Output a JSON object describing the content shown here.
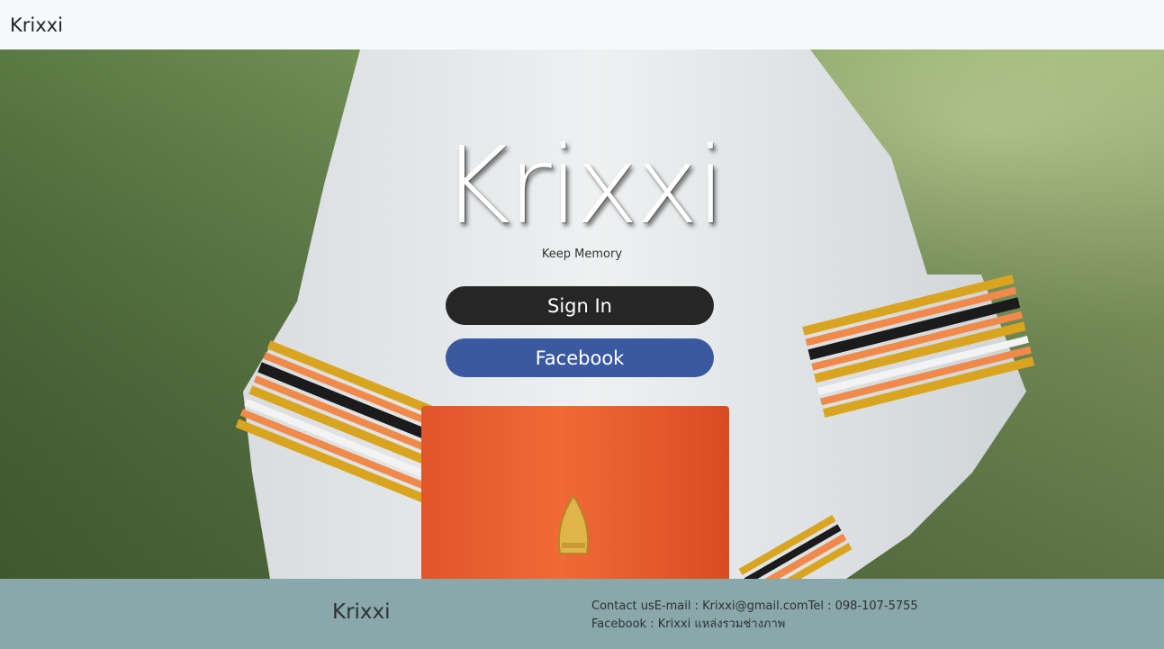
{
  "navbar": {
    "brand": "Krixxi"
  },
  "hero": {
    "title": "Krixxi",
    "tagline": "Keep Memory",
    "signin_label": "Sign In",
    "facebook_label": "Facebook"
  },
  "footer": {
    "brand": "Krixxi",
    "contact_line": "Contact usE-mail : Krixxi@gmail.comTel : 098-107-5755",
    "facebook_line": "Facebook : Krixxi แหล่งรวมช่างภาพ"
  },
  "colors": {
    "signin_button": "#262626",
    "facebook_button": "#3b59a0",
    "footer_bg": "#8aa8ab",
    "navbar_bg": "#f8f9fa"
  }
}
